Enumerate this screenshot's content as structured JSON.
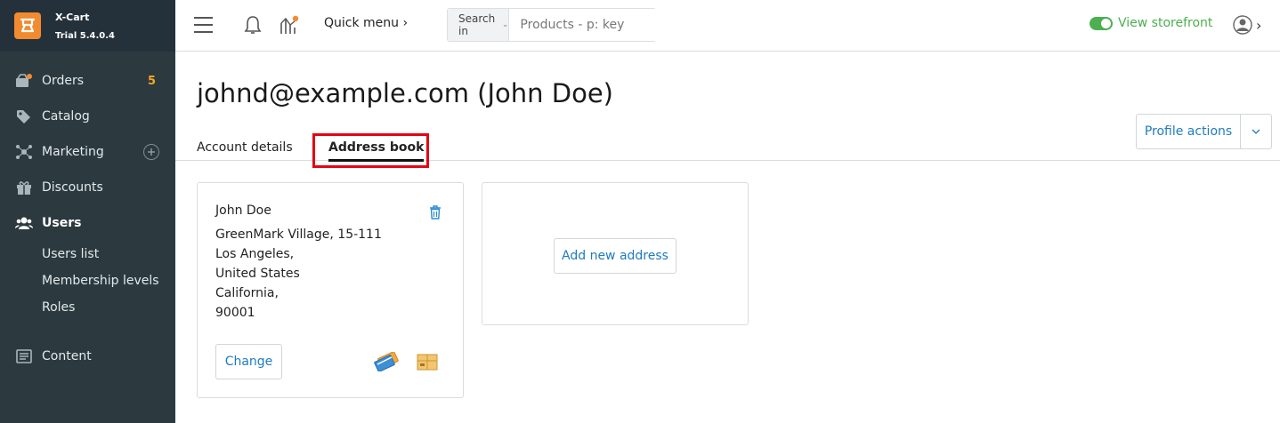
{
  "brand": {
    "name": "X-Cart",
    "version": "Trial 5.4.0.4",
    "accent": "#f28b30"
  },
  "sidebar": {
    "items": [
      {
        "label": "Orders",
        "icon": "orders-icon",
        "badge": "5"
      },
      {
        "label": "Catalog",
        "icon": "tag-icon"
      },
      {
        "label": "Marketing",
        "icon": "marketing-icon",
        "action": "plus-icon"
      },
      {
        "label": "Discounts",
        "icon": "gift-icon"
      },
      {
        "label": "Users",
        "icon": "users-icon",
        "active": true
      },
      {
        "label": "Content",
        "icon": "content-icon"
      }
    ],
    "users_sub": [
      "Users list",
      "Membership levels",
      "Roles"
    ]
  },
  "topbar": {
    "quick_menu": "Quick menu",
    "search_in": "Search in",
    "search_placeholder": "Products - p: key",
    "view_storefront": "View storefront"
  },
  "main": {
    "title": "johnd@example.com (John Doe)",
    "profile_actions": "Profile actions",
    "tabs": [
      "Account details",
      "Address book"
    ],
    "active_tab": "Address book",
    "address": {
      "name": "John Doe",
      "street": "GreenMark Village, 15-111",
      "city": "Los Angeles,",
      "country": "United States",
      "state": "California,",
      "zip": "90001",
      "change_label": "Change"
    },
    "add_new_label": "Add new address"
  },
  "colors": {
    "sidebar_bg": "#2c3a3f",
    "link": "#1f7bbd",
    "highlight": "#e30613",
    "success": "#4caf50",
    "badge": "#f5a623"
  }
}
